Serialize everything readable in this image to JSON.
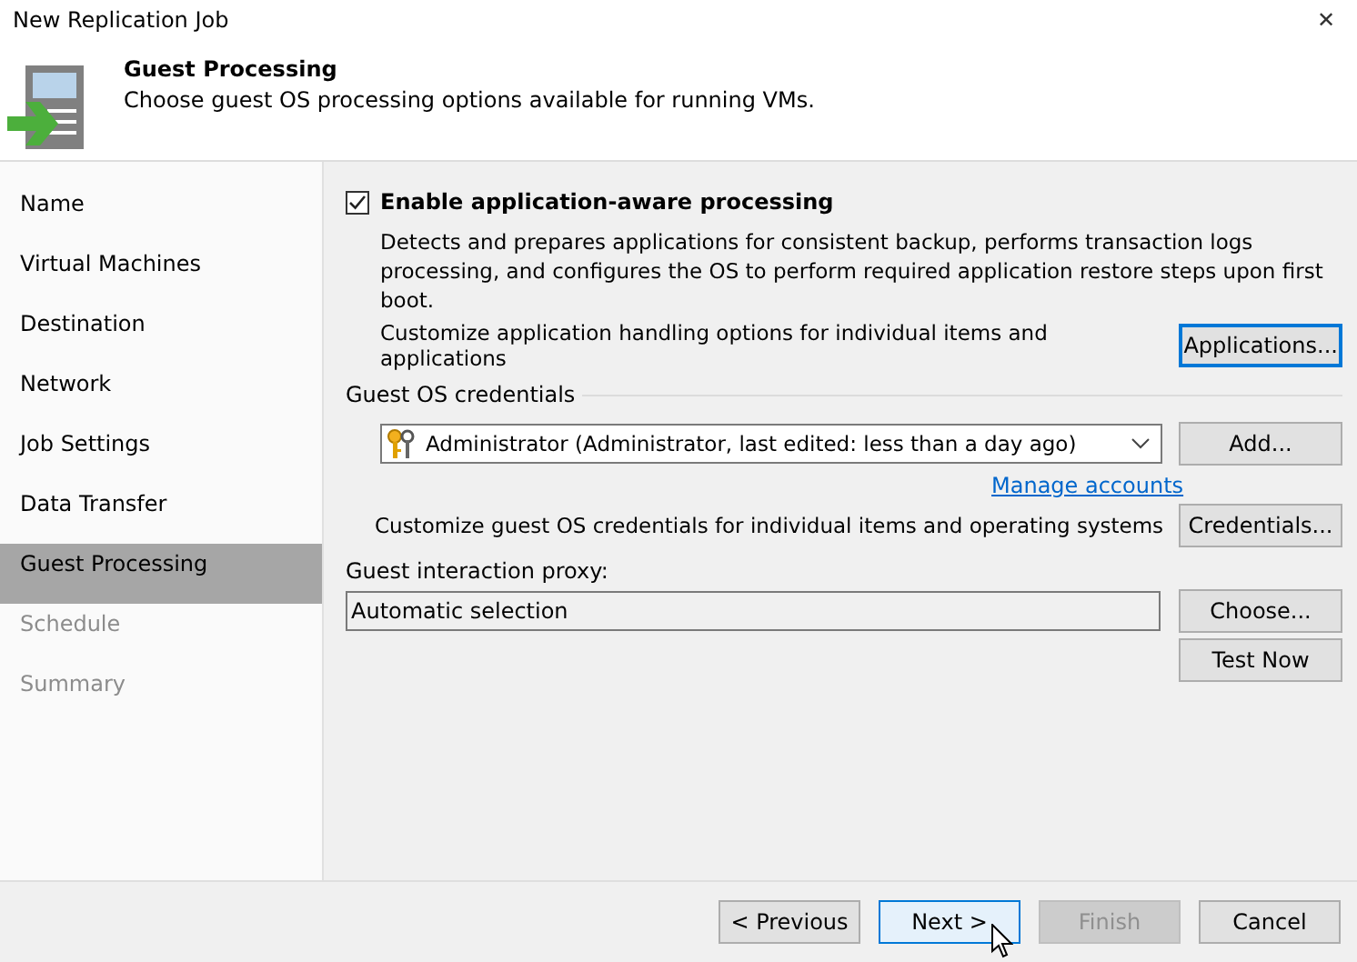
{
  "window": {
    "title": "New Replication Job",
    "close": "✕"
  },
  "header": {
    "title": "Guest Processing",
    "subtitle": "Choose guest OS processing options available for running VMs."
  },
  "sidebar": {
    "items": [
      {
        "label": "Name",
        "selected": false,
        "disabled": false
      },
      {
        "label": "Virtual Machines",
        "selected": false,
        "disabled": false
      },
      {
        "label": "Destination",
        "selected": false,
        "disabled": false
      },
      {
        "label": "Network",
        "selected": false,
        "disabled": false
      },
      {
        "label": "Job Settings",
        "selected": false,
        "disabled": false
      },
      {
        "label": "Data Transfer",
        "selected": false,
        "disabled": false
      },
      {
        "label": "Guest Processing",
        "selected": true,
        "disabled": false
      },
      {
        "label": "Schedule",
        "selected": false,
        "disabled": true
      },
      {
        "label": "Summary",
        "selected": false,
        "disabled": true
      }
    ]
  },
  "app_aware": {
    "label": "Enable application-aware processing",
    "checked": true,
    "description": "Detects and prepares applications for consistent backup, performs transaction logs processing, and configures the OS to perform required application restore steps upon first boot.",
    "customize_text": "Customize application handling options for individual items and applications",
    "button": "Applications..."
  },
  "credentials": {
    "legend": "Guest OS credentials",
    "value": "Administrator (Administrator, last edited: less than a day ago)",
    "add_button": "Add...",
    "manage_link": "Manage accounts",
    "customize_text": "Customize guest OS credentials for individual items and operating systems",
    "button": "Credentials..."
  },
  "proxy": {
    "label": "Guest interaction proxy:",
    "value": "Automatic selection",
    "choose_button": "Choose...",
    "test_button": "Test Now"
  },
  "footer": {
    "buttons": [
      {
        "label": "< Previous",
        "disabled": false,
        "focused": false
      },
      {
        "label": "Next >",
        "disabled": false,
        "focused": true
      },
      {
        "label": "Finish",
        "disabled": true,
        "focused": false
      },
      {
        "label": "Cancel",
        "disabled": false,
        "focused": false
      }
    ]
  }
}
